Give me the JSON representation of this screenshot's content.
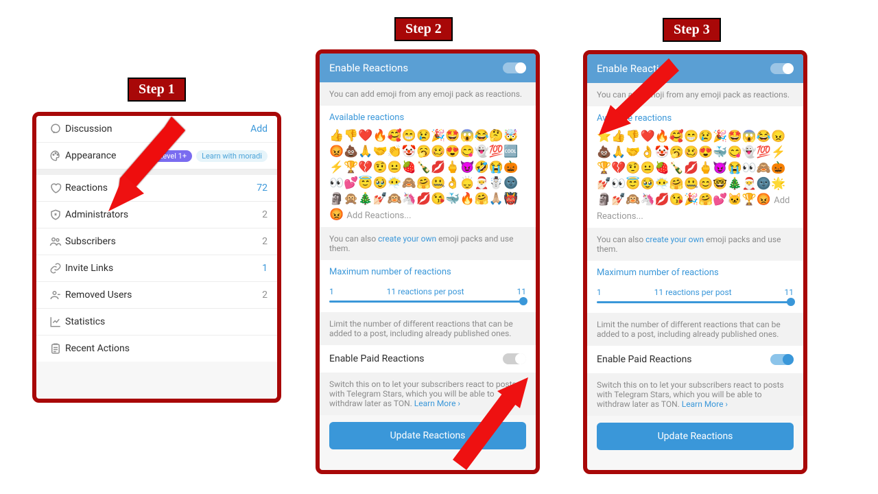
{
  "steps": {
    "s1": "Step 1",
    "s2": "Step 2",
    "s3": "Step 3"
  },
  "step1": {
    "rows": {
      "discussion": {
        "label": "Discussion",
        "value": "Add"
      },
      "appearance": {
        "label": "Appearance",
        "level": "Level 1+",
        "learn": "Learn with moradi"
      },
      "reactions": {
        "label": "Reactions",
        "value": "72"
      },
      "admins": {
        "label": "Administrators",
        "value": "2"
      },
      "subs": {
        "label": "Subscribers",
        "value": "2"
      },
      "invite": {
        "label": "Invite Links",
        "value": "1"
      },
      "removed": {
        "label": "Removed Users",
        "value": "2"
      },
      "stats": {
        "label": "Statistics"
      },
      "recent": {
        "label": "Recent Actions"
      }
    }
  },
  "common": {
    "enable_header": "Enable Reactions",
    "desc1": "You can add emoji from any emoji pack as reactions.",
    "available": "Available reactions",
    "add_reactions": "Add Reactions...",
    "create_hint_pre": "You can also ",
    "create_hint_link": "create your own",
    "create_hint_post": " emoji packs and use them.",
    "max_title": "Maximum number of reactions",
    "slider_min": "1",
    "slider_label": "11 reactions per post",
    "slider_max": "11",
    "limit_hint": "Limit the number of different reactions that can be added to a post, including already published ones.",
    "paid_label": "Enable Paid Reactions",
    "paid_hint_pre": "Switch this on to let your subscribers react to posts with Telegram Stars, which you will be able to withdraw later as TON. ",
    "paid_hint_link": "Learn More ›",
    "update_btn": "Update Reactions"
  },
  "emoji": {
    "step2": "👍👎❤️🔥🥰😁😢🎉🤩😱😂🤔🤯😡💩🙏🤝👏🤡🥱🥴😍😋👻💯🆒⚡🏆💔🤨😐🍓🍾💋🖕😈🤣😭🎃👀💕😇🥹😶‍🌫️🙈🤗🤐👌🙂‍↕️🎅☃️🌚🗿🙊🎄💅🏻🙉🦄💋😘🐳🔥🤗🙏🏼👹😡",
    "step3": "⭐👍👎❤️🔥🥰😁😢🎉🤩😱😂😠💩🙏🤝👌🤡🥱🥴😍🐳😋👻💯⚡🏆💔🤨😐🍓🍾💋🖕😈😭👀🙈🎃💅🏻👀😇🥹😶‍🌫️🤗🤐😊🤓🎄🎅🌚🌟🗿💅🏻🙉🦄💋😘🎉🤗💕🐱🏆😡"
  }
}
